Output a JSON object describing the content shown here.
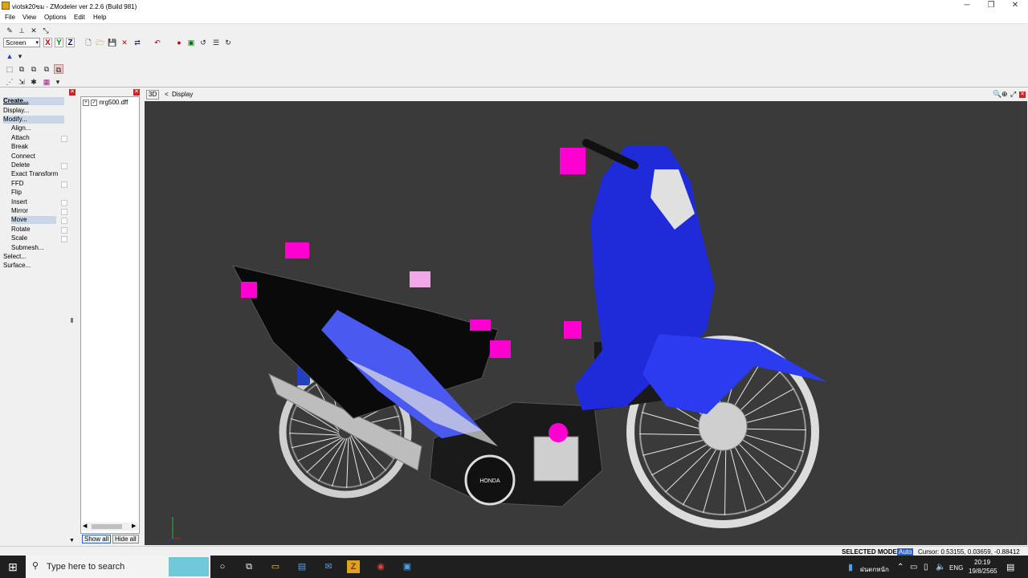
{
  "window": {
    "title": "viotsk20ขม - ZModeler ver 2.2.6 (Build 981)",
    "min_glyph": "─",
    "max_glyph": "❐",
    "close_glyph": "✕"
  },
  "menu": [
    "File",
    "View",
    "Options",
    "Edit",
    "Help"
  ],
  "toolbar": {
    "coord_select": "Screen",
    "axes": [
      "X",
      "Y",
      "Z"
    ]
  },
  "commands": {
    "create": "Create...",
    "display": "Display...",
    "modify": "Modify...",
    "items": [
      "Align...",
      "Attach",
      "Break",
      "Connect",
      "Delete",
      "Exact Transform",
      "FFD",
      "Flip",
      "Insert",
      "Mirror",
      "Move",
      "Rotate",
      "Scale",
      "Submesh..."
    ],
    "select": "Select...",
    "surface": "Surface..."
  },
  "tree": {
    "expand": "+",
    "checked": "✓",
    "file": "nrg500.dff"
  },
  "tree_buttons": {
    "show_all": "Show all",
    "hide_all": "Hide all"
  },
  "viewport": {
    "mode_label": "3D",
    "back_glyph": "<",
    "display_label": "Display",
    "background": "#3a3a3a",
    "body_color": "#1f2ad8",
    "marker_color": "#ff00d0",
    "seat_color": "#111111",
    "model_brand": "HONDA"
  },
  "status": {
    "mode": "SELECTED MODE",
    "auto": "Auto",
    "cursor": "Cursor: 0.53155, 0.03659, -0.88412"
  },
  "taskbar": {
    "search_placeholder": "Type here to search",
    "keyboard": "ENG",
    "locale": "ฝนตกหนัก",
    "time": "20:19",
    "date": "19/8/2565"
  }
}
